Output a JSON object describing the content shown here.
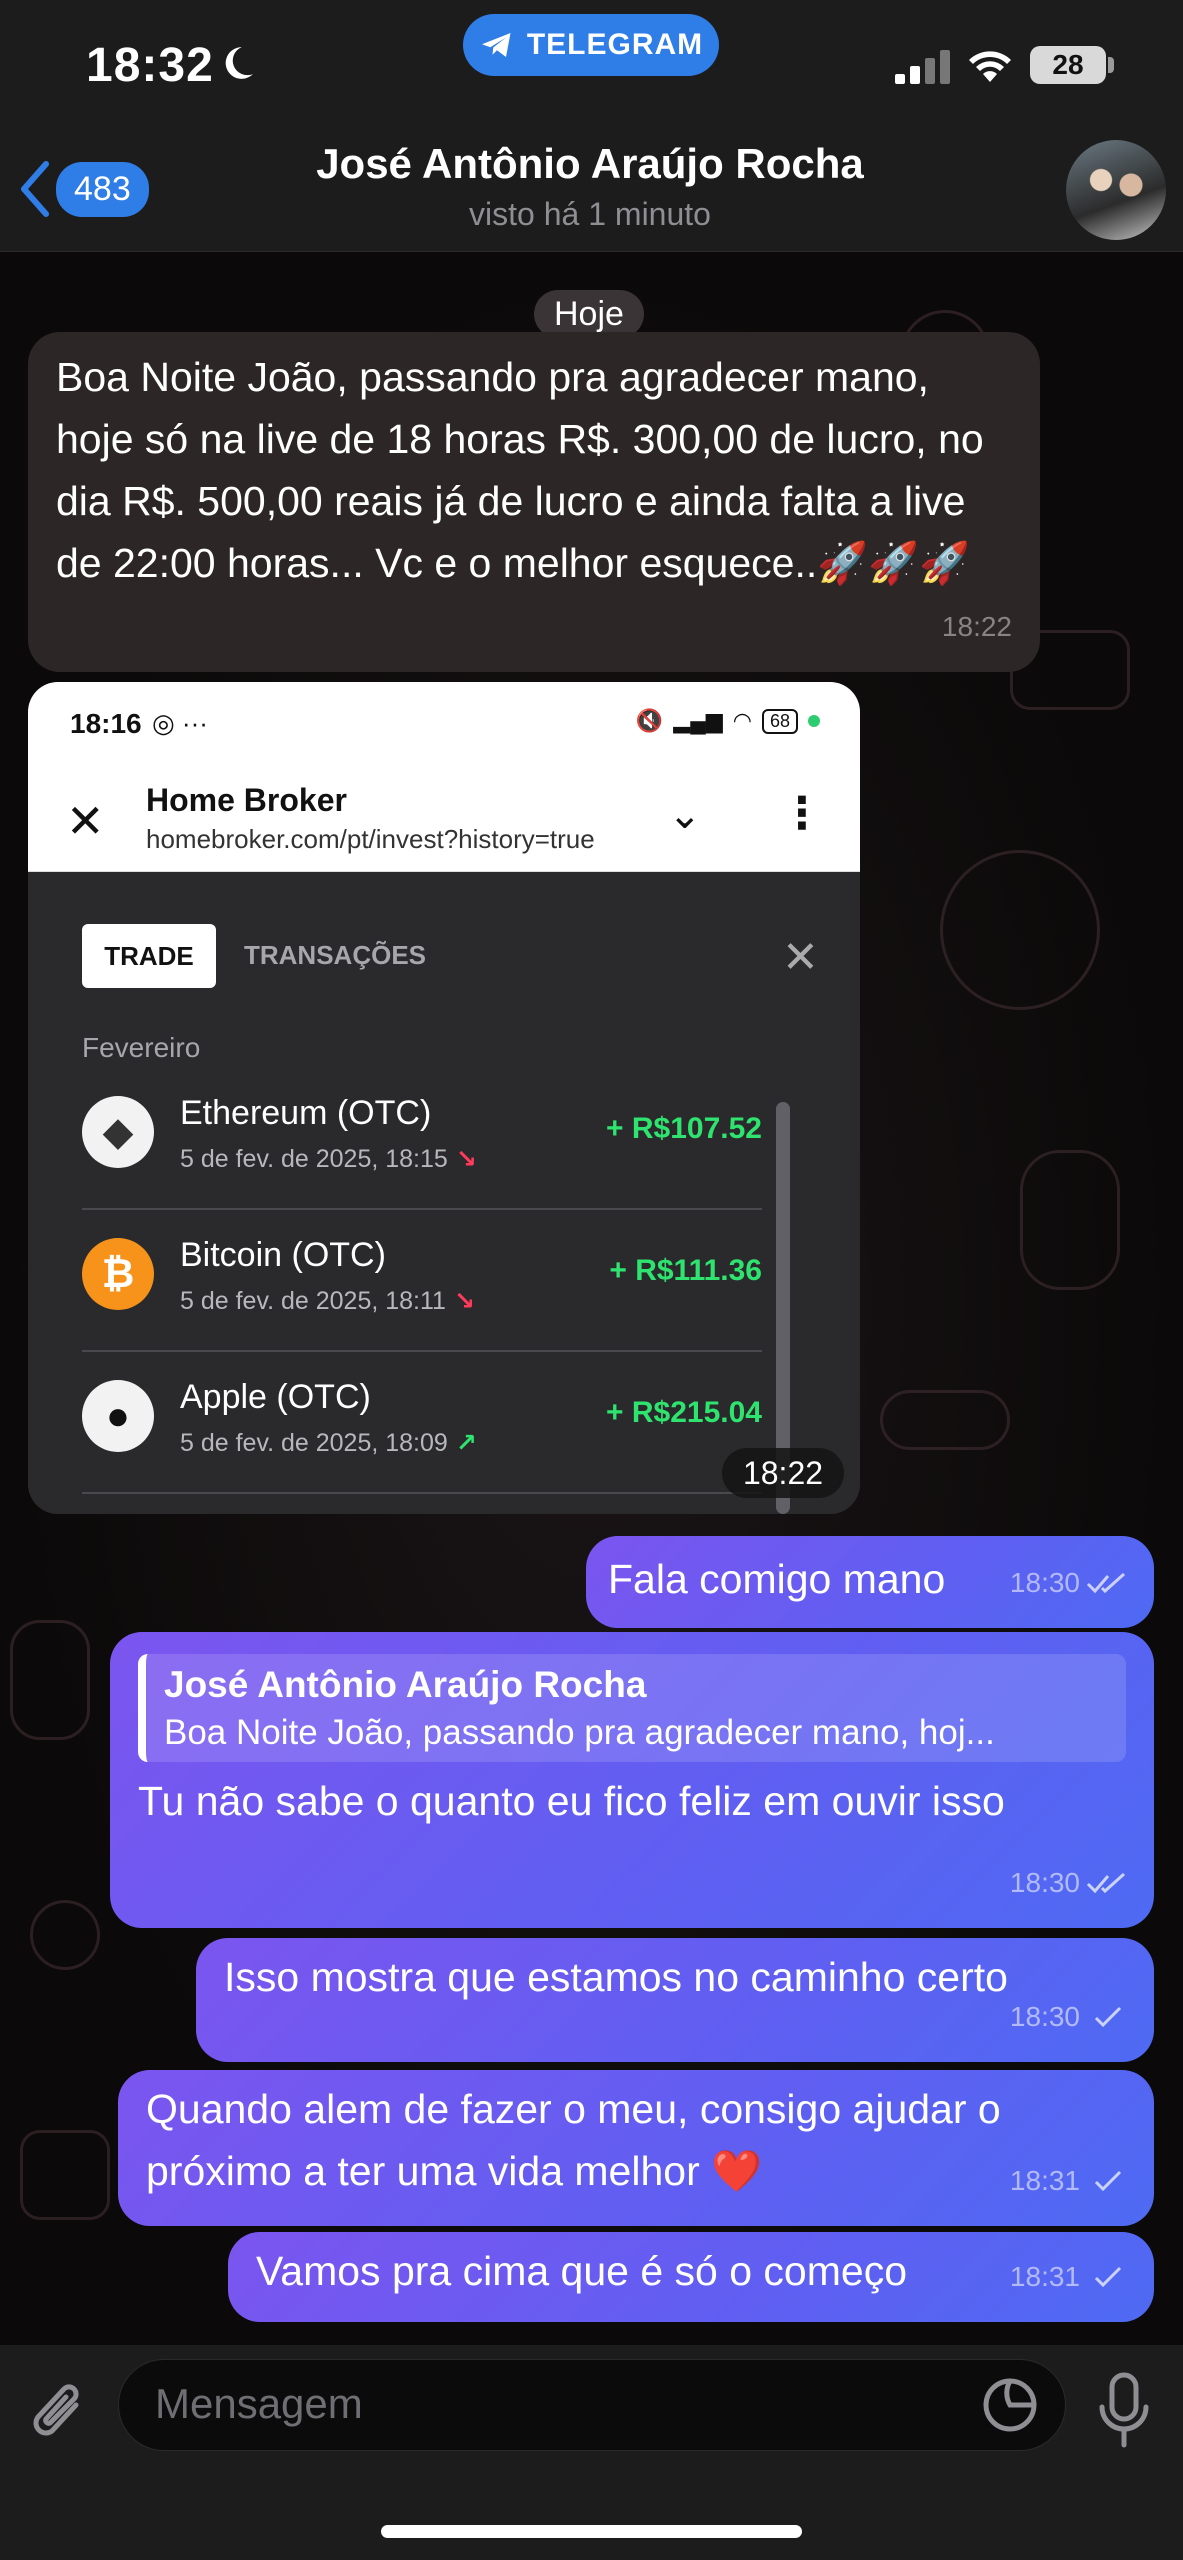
{
  "status_bar": {
    "time": "18:32",
    "app_pill": "TELEGRAM",
    "battery": "28"
  },
  "header": {
    "back_count": "483",
    "contact_name": "José Antônio Araújo Rocha",
    "contact_status": "visto há 1 minuto"
  },
  "chat": {
    "date_chip": "Hoje",
    "messages": [
      {
        "text": "Boa Noite João, passando pra agradecer mano, hoje só na live de 18 horas R$. 300,00 de lucro, no dia R$. 500,00 reais já de lucro e ainda falta a live de 22:00 horas... Vc e o melhor esquece..🚀🚀🚀",
        "time": "18:22"
      },
      {
        "image_time": "18:22",
        "screenshot": {
          "time": "18:16",
          "battery": "68",
          "title": "Home Broker",
          "url": "homebroker.com/pt/invest?history=true",
          "tab_active": "TRADE",
          "tab_inactive": "TRANSAÇÕES",
          "month": "Fevereiro",
          "trades": [
            {
              "name": "Ethereum (OTC)",
              "date": "5 de fev. de 2025, 18:15",
              "amount": "+ R$107.52",
              "trend": "down"
            },
            {
              "name": "Bitcoin (OTC)",
              "date": "5 de fev. de 2025, 18:11",
              "amount": "+ R$111.36",
              "trend": "down"
            },
            {
              "name": "Apple (OTC)",
              "date": "5 de fev. de 2025, 18:09",
              "amount": "+ R$215.04",
              "trend": "up"
            }
          ]
        }
      },
      {
        "text": "Fala comigo mano",
        "time": "18:30"
      },
      {
        "reply_name": "José Antônio Araújo Rocha",
        "reply_text": "Boa Noite João, passando pra agradecer mano, hoj...",
        "text": "Tu não sabe o quanto eu fico feliz em ouvir isso",
        "time": "18:30"
      },
      {
        "text": "Isso mostra que estamos no caminho certo",
        "time": "18:30"
      },
      {
        "text": "Quando alem de fazer o meu, consigo ajudar o próximo a ter uma vida melhor ❤️",
        "time": "18:31"
      },
      {
        "text": "Vamos pra cima que é só o começo",
        "time": "18:31"
      }
    ]
  },
  "input": {
    "placeholder": "Mensagem"
  },
  "colors": {
    "accent": "#2f7de6",
    "outgoing_start": "#7b55ef",
    "outgoing_end": "#4e6af3",
    "incoming": "#2c2627",
    "profit": "#2ee46f"
  }
}
